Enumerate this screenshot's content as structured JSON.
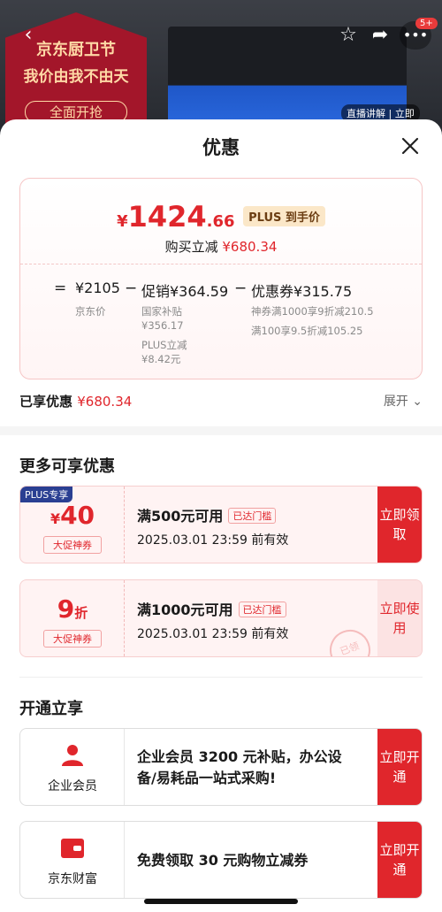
{
  "background": {
    "poster_line1": "京东厨卫节",
    "poster_line2": "我价由我不由天",
    "poster_line3": "全面开抢",
    "more_badge": "5+",
    "live_chip": "直播讲解 | 立即"
  },
  "sheet": {
    "title": "优惠"
  },
  "price_card": {
    "currency": "¥",
    "price_int": "1424",
    "price_dec": ".66",
    "plus_tag": "PLUS 到手价",
    "reduce_label": "购买立减",
    "reduce_value": "¥680.34",
    "formula": {
      "eq": "=",
      "jd_price": "¥2105",
      "jd_price_label": "京东价",
      "minus1": "−",
      "promo": "促销¥364.59",
      "promo_sub1": "国家补贴",
      "promo_sub1_val": "¥356.17",
      "promo_sub2": "PLUS立减",
      "promo_sub2_val": "¥8.42元",
      "minus2": "−",
      "coupon": "优惠券¥315.75",
      "coupon_sub1": "神券满1000享9折减210.5",
      "coupon_sub2": "满100享9.5折减105.25"
    }
  },
  "saved": {
    "label": "已享优惠",
    "value": "¥680.34",
    "expand": "展开 ⌄"
  },
  "more_section": {
    "title": "更多可享优惠",
    "coupons": [
      {
        "corner": "PLUS专享",
        "currency": "¥",
        "amount": "40",
        "kind": "大促神券",
        "condition": "满500元可用",
        "reach": "已达门槛",
        "expire": "2025.03.01 23:59 前有效",
        "action": "立即领取"
      },
      {
        "amount": "9",
        "unit": "折",
        "kind": "大促神券",
        "condition": "满1000元可用",
        "reach": "已达门槛",
        "expire": "2025.03.01 23:59 前有效",
        "action": "立即使用",
        "stamp": "已领"
      }
    ]
  },
  "open_section": {
    "title": "开通立享",
    "items": [
      {
        "name": "企业会员",
        "desc_line1": "企业会员 3200 元补贴，办公设",
        "desc_line2": "备/易耗品一站式采购!",
        "action": "立即开通"
      },
      {
        "name": "京东财富",
        "desc_line1": "免费领取 30 元购物立减券",
        "action": "立即开通"
      }
    ]
  },
  "colors": {
    "accent_red": "#e0262c",
    "plus_navy": "#2a3f92",
    "plus_gold": "#fbe7c8"
  }
}
